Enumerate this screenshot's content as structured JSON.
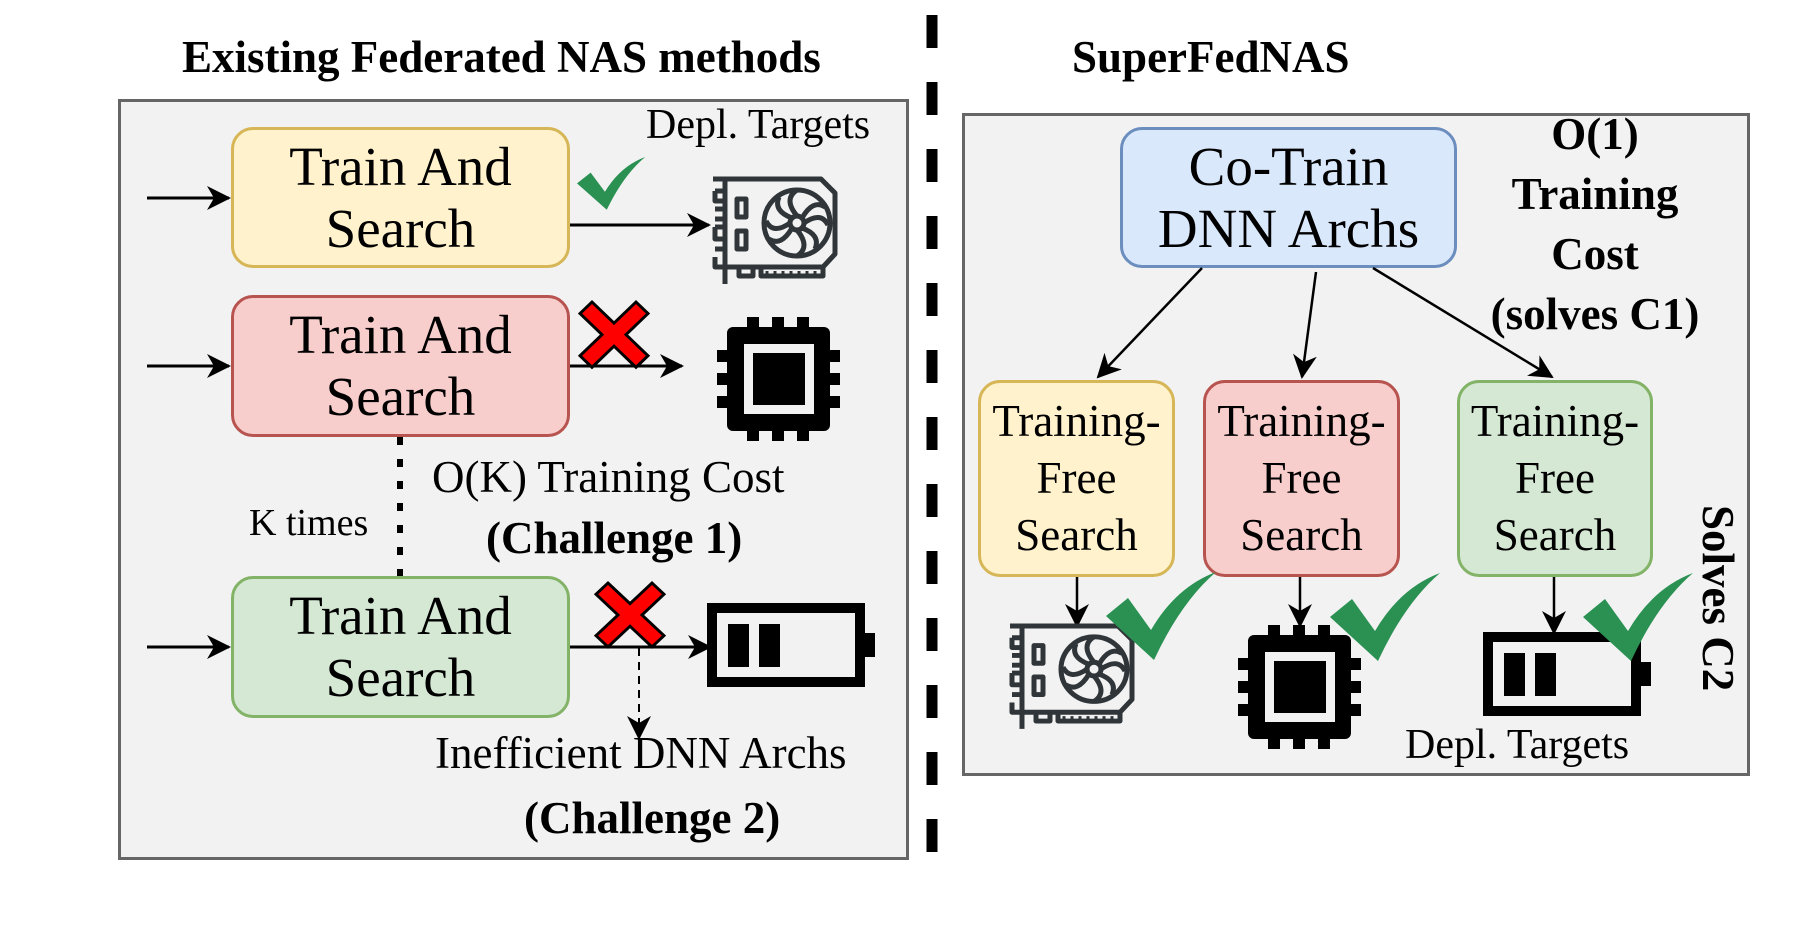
{
  "colors": {
    "panel_fill": "#f2f2f2",
    "panel_border": "#666666",
    "yellow_fill": "#fff2cc",
    "yellow_border": "#d6b656",
    "red_fill": "#f8cecc",
    "red_border": "#b85450",
    "green_fill": "#d5e8d4",
    "green_border": "#82b366",
    "blue_fill": "#dae8fc",
    "blue_border": "#6c8ebf",
    "check": "#2a9153",
    "cross": "#ff0000",
    "gpu_stroke": "#2f3538"
  },
  "left": {
    "title": "Existing Federated NAS methods",
    "depl_targets": "Depl. Targets",
    "nodes": [
      {
        "line1": "Train And",
        "line2": "Search",
        "color": "yellow",
        "target": "gpu-icon",
        "status": "check"
      },
      {
        "line1": "Train And",
        "line2": "Search",
        "color": "red",
        "target": "cpu-icon",
        "status": "cross"
      },
      {
        "line1": "Train And",
        "line2": "Search",
        "color": "green",
        "target": "battery-icon",
        "status": "cross"
      }
    ],
    "k_times": "K times",
    "cost_label": "O(K) Training Cost",
    "challenge1": "(Challenge 1)",
    "inefficient_label": "Inefficient DNN Archs",
    "challenge2": "(Challenge 2)"
  },
  "right": {
    "title": "SuperFedNAS",
    "cotrain": {
      "line1": "Co-Train",
      "line2": "DNN Archs"
    },
    "cost_lines": [
      "O(1)",
      "Training",
      "Cost",
      "(solves C1)"
    ],
    "search_nodes": [
      {
        "line1": "Training-",
        "line2": "Free",
        "line3": "Search",
        "color": "yellow",
        "target": "gpu-icon",
        "status": "check"
      },
      {
        "line1": "Training-",
        "line2": "Free",
        "line3": "Search",
        "color": "red",
        "target": "cpu-icon",
        "status": "check"
      },
      {
        "line1": "Training-",
        "line2": "Free",
        "line3": "Search",
        "color": "green",
        "target": "battery-icon",
        "status": "check"
      }
    ],
    "solves_c2": "Solves C2",
    "depl_targets": "Depl. Targets"
  }
}
